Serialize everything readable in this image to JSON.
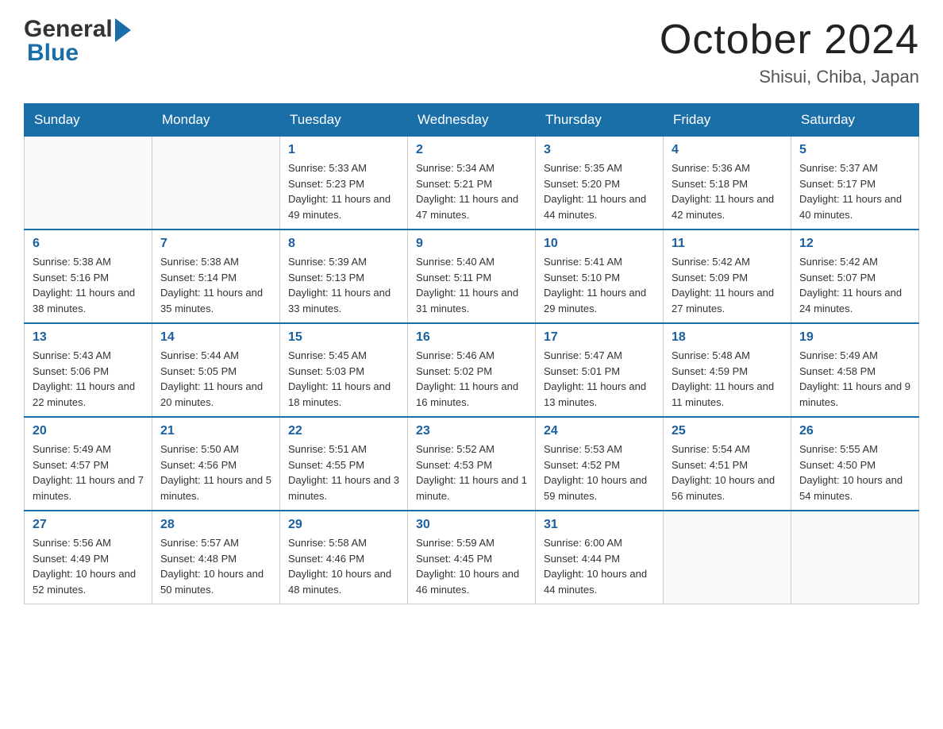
{
  "header": {
    "logo_general": "General",
    "logo_blue": "Blue",
    "title": "October 2024",
    "subtitle": "Shisui, Chiba, Japan"
  },
  "days_of_week": [
    "Sunday",
    "Monday",
    "Tuesday",
    "Wednesday",
    "Thursday",
    "Friday",
    "Saturday"
  ],
  "weeks": [
    {
      "days": [
        {
          "number": "",
          "sunrise": "",
          "sunset": "",
          "daylight": ""
        },
        {
          "number": "",
          "sunrise": "",
          "sunset": "",
          "daylight": ""
        },
        {
          "number": "1",
          "sunrise": "Sunrise: 5:33 AM",
          "sunset": "Sunset: 5:23 PM",
          "daylight": "Daylight: 11 hours and 49 minutes."
        },
        {
          "number": "2",
          "sunrise": "Sunrise: 5:34 AM",
          "sunset": "Sunset: 5:21 PM",
          "daylight": "Daylight: 11 hours and 47 minutes."
        },
        {
          "number": "3",
          "sunrise": "Sunrise: 5:35 AM",
          "sunset": "Sunset: 5:20 PM",
          "daylight": "Daylight: 11 hours and 44 minutes."
        },
        {
          "number": "4",
          "sunrise": "Sunrise: 5:36 AM",
          "sunset": "Sunset: 5:18 PM",
          "daylight": "Daylight: 11 hours and 42 minutes."
        },
        {
          "number": "5",
          "sunrise": "Sunrise: 5:37 AM",
          "sunset": "Sunset: 5:17 PM",
          "daylight": "Daylight: 11 hours and 40 minutes."
        }
      ]
    },
    {
      "days": [
        {
          "number": "6",
          "sunrise": "Sunrise: 5:38 AM",
          "sunset": "Sunset: 5:16 PM",
          "daylight": "Daylight: 11 hours and 38 minutes."
        },
        {
          "number": "7",
          "sunrise": "Sunrise: 5:38 AM",
          "sunset": "Sunset: 5:14 PM",
          "daylight": "Daylight: 11 hours and 35 minutes."
        },
        {
          "number": "8",
          "sunrise": "Sunrise: 5:39 AM",
          "sunset": "Sunset: 5:13 PM",
          "daylight": "Daylight: 11 hours and 33 minutes."
        },
        {
          "number": "9",
          "sunrise": "Sunrise: 5:40 AM",
          "sunset": "Sunset: 5:11 PM",
          "daylight": "Daylight: 11 hours and 31 minutes."
        },
        {
          "number": "10",
          "sunrise": "Sunrise: 5:41 AM",
          "sunset": "Sunset: 5:10 PM",
          "daylight": "Daylight: 11 hours and 29 minutes."
        },
        {
          "number": "11",
          "sunrise": "Sunrise: 5:42 AM",
          "sunset": "Sunset: 5:09 PM",
          "daylight": "Daylight: 11 hours and 27 minutes."
        },
        {
          "number": "12",
          "sunrise": "Sunrise: 5:42 AM",
          "sunset": "Sunset: 5:07 PM",
          "daylight": "Daylight: 11 hours and 24 minutes."
        }
      ]
    },
    {
      "days": [
        {
          "number": "13",
          "sunrise": "Sunrise: 5:43 AM",
          "sunset": "Sunset: 5:06 PM",
          "daylight": "Daylight: 11 hours and 22 minutes."
        },
        {
          "number": "14",
          "sunrise": "Sunrise: 5:44 AM",
          "sunset": "Sunset: 5:05 PM",
          "daylight": "Daylight: 11 hours and 20 minutes."
        },
        {
          "number": "15",
          "sunrise": "Sunrise: 5:45 AM",
          "sunset": "Sunset: 5:03 PM",
          "daylight": "Daylight: 11 hours and 18 minutes."
        },
        {
          "number": "16",
          "sunrise": "Sunrise: 5:46 AM",
          "sunset": "Sunset: 5:02 PM",
          "daylight": "Daylight: 11 hours and 16 minutes."
        },
        {
          "number": "17",
          "sunrise": "Sunrise: 5:47 AM",
          "sunset": "Sunset: 5:01 PM",
          "daylight": "Daylight: 11 hours and 13 minutes."
        },
        {
          "number": "18",
          "sunrise": "Sunrise: 5:48 AM",
          "sunset": "Sunset: 4:59 PM",
          "daylight": "Daylight: 11 hours and 11 minutes."
        },
        {
          "number": "19",
          "sunrise": "Sunrise: 5:49 AM",
          "sunset": "Sunset: 4:58 PM",
          "daylight": "Daylight: 11 hours and 9 minutes."
        }
      ]
    },
    {
      "days": [
        {
          "number": "20",
          "sunrise": "Sunrise: 5:49 AM",
          "sunset": "Sunset: 4:57 PM",
          "daylight": "Daylight: 11 hours and 7 minutes."
        },
        {
          "number": "21",
          "sunrise": "Sunrise: 5:50 AM",
          "sunset": "Sunset: 4:56 PM",
          "daylight": "Daylight: 11 hours and 5 minutes."
        },
        {
          "number": "22",
          "sunrise": "Sunrise: 5:51 AM",
          "sunset": "Sunset: 4:55 PM",
          "daylight": "Daylight: 11 hours and 3 minutes."
        },
        {
          "number": "23",
          "sunrise": "Sunrise: 5:52 AM",
          "sunset": "Sunset: 4:53 PM",
          "daylight": "Daylight: 11 hours and 1 minute."
        },
        {
          "number": "24",
          "sunrise": "Sunrise: 5:53 AM",
          "sunset": "Sunset: 4:52 PM",
          "daylight": "Daylight: 10 hours and 59 minutes."
        },
        {
          "number": "25",
          "sunrise": "Sunrise: 5:54 AM",
          "sunset": "Sunset: 4:51 PM",
          "daylight": "Daylight: 10 hours and 56 minutes."
        },
        {
          "number": "26",
          "sunrise": "Sunrise: 5:55 AM",
          "sunset": "Sunset: 4:50 PM",
          "daylight": "Daylight: 10 hours and 54 minutes."
        }
      ]
    },
    {
      "days": [
        {
          "number": "27",
          "sunrise": "Sunrise: 5:56 AM",
          "sunset": "Sunset: 4:49 PM",
          "daylight": "Daylight: 10 hours and 52 minutes."
        },
        {
          "number": "28",
          "sunrise": "Sunrise: 5:57 AM",
          "sunset": "Sunset: 4:48 PM",
          "daylight": "Daylight: 10 hours and 50 minutes."
        },
        {
          "number": "29",
          "sunrise": "Sunrise: 5:58 AM",
          "sunset": "Sunset: 4:46 PM",
          "daylight": "Daylight: 10 hours and 48 minutes."
        },
        {
          "number": "30",
          "sunrise": "Sunrise: 5:59 AM",
          "sunset": "Sunset: 4:45 PM",
          "daylight": "Daylight: 10 hours and 46 minutes."
        },
        {
          "number": "31",
          "sunrise": "Sunrise: 6:00 AM",
          "sunset": "Sunset: 4:44 PM",
          "daylight": "Daylight: 10 hours and 44 minutes."
        },
        {
          "number": "",
          "sunrise": "",
          "sunset": "",
          "daylight": ""
        },
        {
          "number": "",
          "sunrise": "",
          "sunset": "",
          "daylight": ""
        }
      ]
    }
  ]
}
